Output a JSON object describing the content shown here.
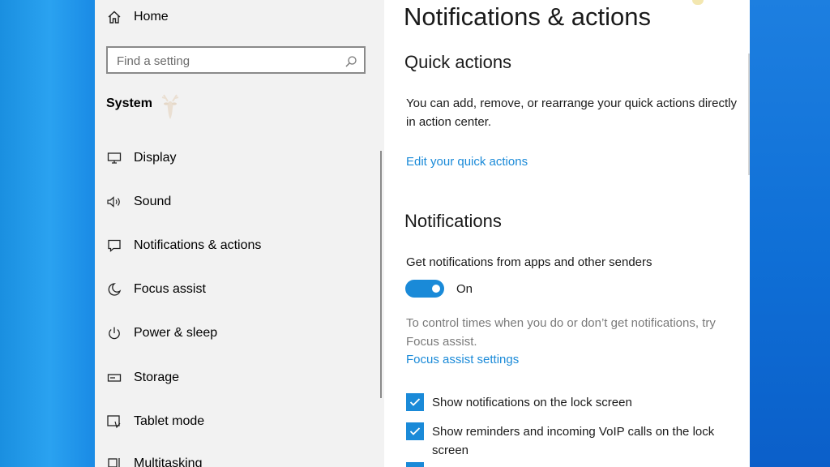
{
  "sidebar": {
    "home_label": "Home",
    "search_placeholder": "Find a setting",
    "section_title": "System",
    "items": [
      {
        "label": "Display",
        "icon": "display-icon"
      },
      {
        "label": "Sound",
        "icon": "speaker-icon"
      },
      {
        "label": "Notifications & actions",
        "icon": "message-icon"
      },
      {
        "label": "Focus assist",
        "icon": "moon-icon"
      },
      {
        "label": "Power & sleep",
        "icon": "power-icon"
      },
      {
        "label": "Storage",
        "icon": "storage-icon"
      },
      {
        "label": "Tablet mode",
        "icon": "tablet-icon"
      },
      {
        "label": "Multitasking",
        "icon": "multitasking-icon"
      }
    ]
  },
  "main": {
    "page_title": "Notifications & actions",
    "quick_actions": {
      "heading": "Quick actions",
      "description": "You can add, remove, or rearrange your quick actions directly in action center.",
      "link": "Edit your quick actions"
    },
    "notifications": {
      "heading": "Notifications",
      "toggle_caption": "Get notifications from apps and other senders",
      "toggle_state": "On",
      "toggle_on": true,
      "focus_text": "To control times when you do or don’t get notifications, try Focus assist.",
      "focus_link": "Focus assist settings",
      "checkboxes": [
        {
          "label": "Show notifications on the lock screen",
          "checked": true
        },
        {
          "label": "Show reminders and incoming VoIP calls on the lock screen",
          "checked": true
        }
      ]
    }
  },
  "colors": {
    "accent": "#1a8ad8",
    "sidebar_bg": "#f2f2f2",
    "desktop": "#0f78d8"
  }
}
